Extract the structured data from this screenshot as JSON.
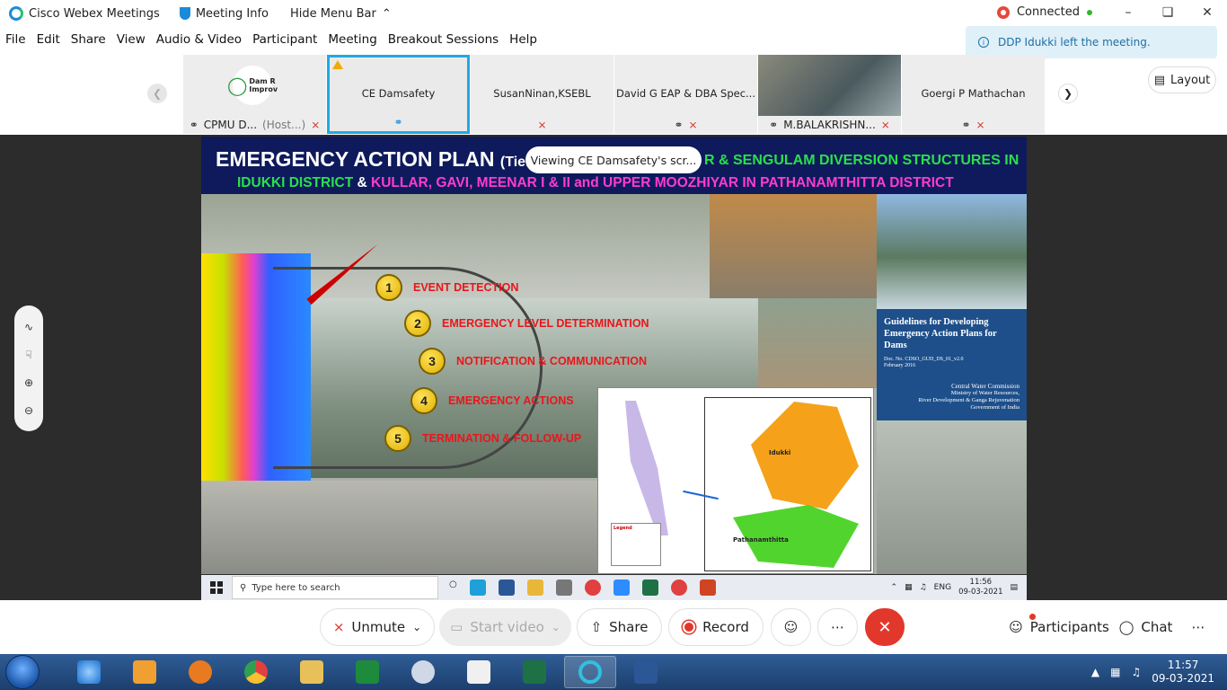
{
  "titlebar": {
    "app_name": "Cisco Webex Meetings",
    "meeting_info": "Meeting Info",
    "hide_menu": "Hide Menu Bar",
    "status": "Connected"
  },
  "menu": [
    "File",
    "Edit",
    "Share",
    "View",
    "Audio & Video",
    "Participant",
    "Meeting",
    "Breakout Sessions",
    "Help"
  ],
  "toast": {
    "message": "DDP Idukki left the meeting."
  },
  "layout_button": "Layout",
  "participants_strip": [
    {
      "name": "CPMU D...",
      "suffix": "(Host...)",
      "logo_text": "Dam R Improv"
    },
    {
      "name": "CE Damsafety"
    },
    {
      "name": "SusanNinan,KSEBL"
    },
    {
      "name": "David G EAP & DBA Spec..."
    },
    {
      "name": "M.BALAKRISHN..."
    },
    {
      "name": "Goergi P Mathachan"
    }
  ],
  "share": {
    "viewing_label": "Viewing CE Damsafety's scr...",
    "slide": {
      "title_main": "EMERGENCY ACTION PLAN",
      "title_paren": "(Tier",
      "title_right": "R & SENGULAM DIVERSION STRUCTURES IN",
      "line2_a": "IDUKKI DISTRICT",
      "line2_amp": "&",
      "line2_b": "KULLAR, GAVI, MEENAR I & II and UPPER MOOZHIYAR IN PATHANAMTHITTA DISTRICT",
      "steps": [
        {
          "num": "1",
          "label": "EVENT DETECTION"
        },
        {
          "num": "2",
          "label": "EMERGENCY LEVEL DETERMINATION"
        },
        {
          "num": "3",
          "label": "NOTIFICATION & COMMUNICATION"
        },
        {
          "num": "4",
          "label": "EMERGENCY ACTIONS"
        },
        {
          "num": "5",
          "label": "TERMINATION & FOLLOW-UP"
        }
      ],
      "book": {
        "title": "Guidelines for Developing Emergency Action Plans for Dams",
        "doc": "Doc. No. CDSO_GUD_DS_01_v2.0",
        "date": "February 2016",
        "org": "Central Water Commission",
        "ministry": "Ministry of Water Resources,",
        "ministry2": "River Development & Ganga Rejuvenation",
        "gov": "Government of India"
      },
      "map_labels": {
        "idukki": "Idukki",
        "pathanamthitta": "Pathanamthitta",
        "legend": "Legend"
      }
    },
    "inner_taskbar": {
      "search_placeholder": "Type here to search",
      "lang": "ENG",
      "time": "11:56",
      "date": "09-03-2021"
    }
  },
  "controls": {
    "unmute": "Unmute",
    "start_video": "Start video",
    "share": "Share",
    "record": "Record",
    "participants": "Participants",
    "chat": "Chat"
  },
  "taskbar": {
    "time": "11:57",
    "date": "09-03-2021"
  },
  "colors": {
    "accent": "#21a9e0",
    "leave": "#e2372b",
    "slide_header": "#0e1a5c"
  }
}
